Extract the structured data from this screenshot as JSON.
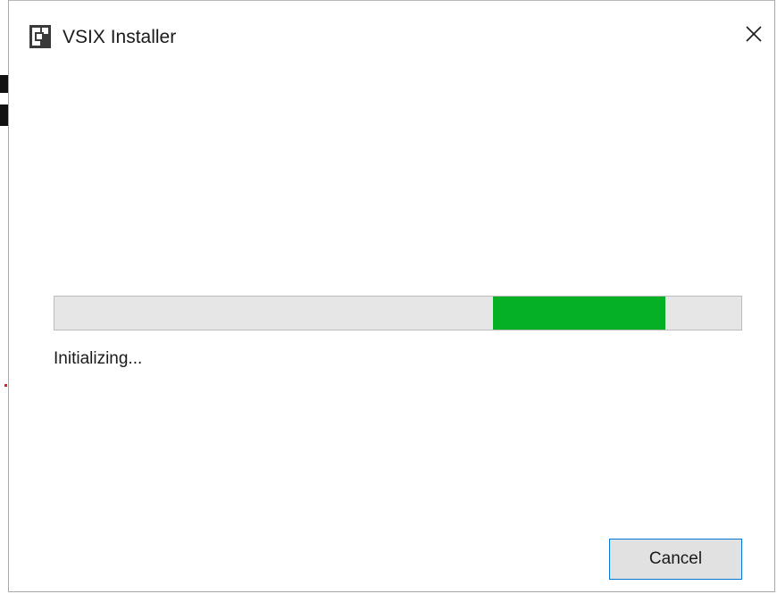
{
  "window": {
    "title": "VSIX Installer",
    "app_icon": "vsix-installer-icon",
    "close_icon": "close-icon"
  },
  "progress": {
    "mode": "indeterminate",
    "segment_start_fraction": 0.638,
    "segment_end_fraction": 0.89,
    "fill_color": "#06b025",
    "track_color": "#e6e6e6"
  },
  "status": {
    "text": "Initializing..."
  },
  "buttons": {
    "cancel_label": "Cancel"
  }
}
